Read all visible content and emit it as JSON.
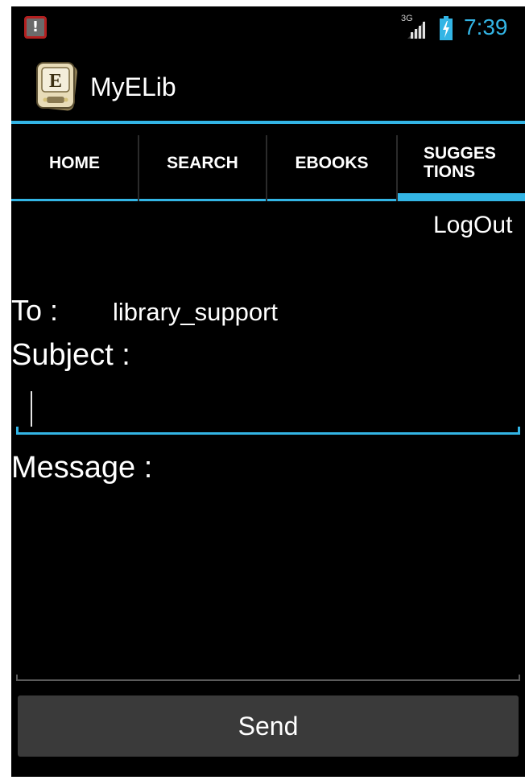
{
  "status_bar": {
    "notification_icon": "alert-icon",
    "notification_glyph": "!",
    "network_label": "3G",
    "signal_icon": "signal-icon",
    "battery_icon": "battery-charging-icon",
    "time": "7:39",
    "clock_color": "#33b5e5"
  },
  "action_bar": {
    "app_title": "MyELib",
    "logo_icon": "ebook-logo-icon",
    "logo_letter": "E",
    "accent_color": "#33b5e5"
  },
  "tabs": [
    {
      "label": "HOME",
      "selected": false
    },
    {
      "label": "SEARCH",
      "selected": false
    },
    {
      "label": "EBOOKS",
      "selected": false
    },
    {
      "label": "SUGGES\nTIONS",
      "selected": true
    }
  ],
  "content": {
    "logout_label": "LogOut",
    "to_label": "To :",
    "to_value": "library_support",
    "subject_label": "Subject :",
    "subject_value": "",
    "message_label": "Message :",
    "message_value": "",
    "send_label": "Send"
  }
}
